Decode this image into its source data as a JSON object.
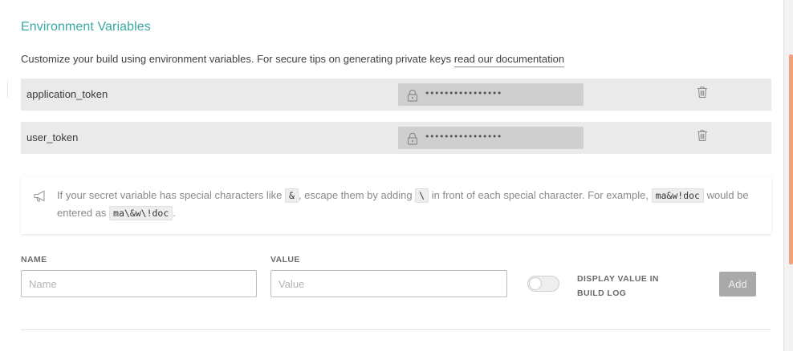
{
  "section": {
    "title": "Environment Variables",
    "description": "Customize your build using environment variables. For secure tips on generating private keys ",
    "doc_link": "read our documentation"
  },
  "variables": [
    {
      "name": "application_token",
      "value_masked": "••••••••••••••••"
    },
    {
      "name": "user_token",
      "value_masked": "••••••••••••••••"
    }
  ],
  "notice": {
    "text_1": "If your secret variable has special characters like ",
    "code_1": "&",
    "text_2": ", escape them by adding ",
    "code_2": "\\",
    "text_3": " in front of each special character. For example, ",
    "code_3": "ma&w!doc",
    "text_4": " would be entered as ",
    "code_4": "ma\\&w\\!doc",
    "text_5": "."
  },
  "form": {
    "name_label": "NAME",
    "name_placeholder": "Name",
    "value_label": "VALUE",
    "value_placeholder": "Value",
    "toggle_label": "DISPLAY VALUE IN BUILD LOG",
    "toggle_on": false,
    "add_label": "Add"
  },
  "colors": {
    "title": "#39aaa3",
    "row_bg": "#eaeaea",
    "add_button": "#a9a9a9",
    "scroll_thumb": "#f2a07b"
  },
  "icons": {
    "lock": "lock-icon",
    "trash": "trash-icon",
    "megaphone": "megaphone-icon"
  }
}
